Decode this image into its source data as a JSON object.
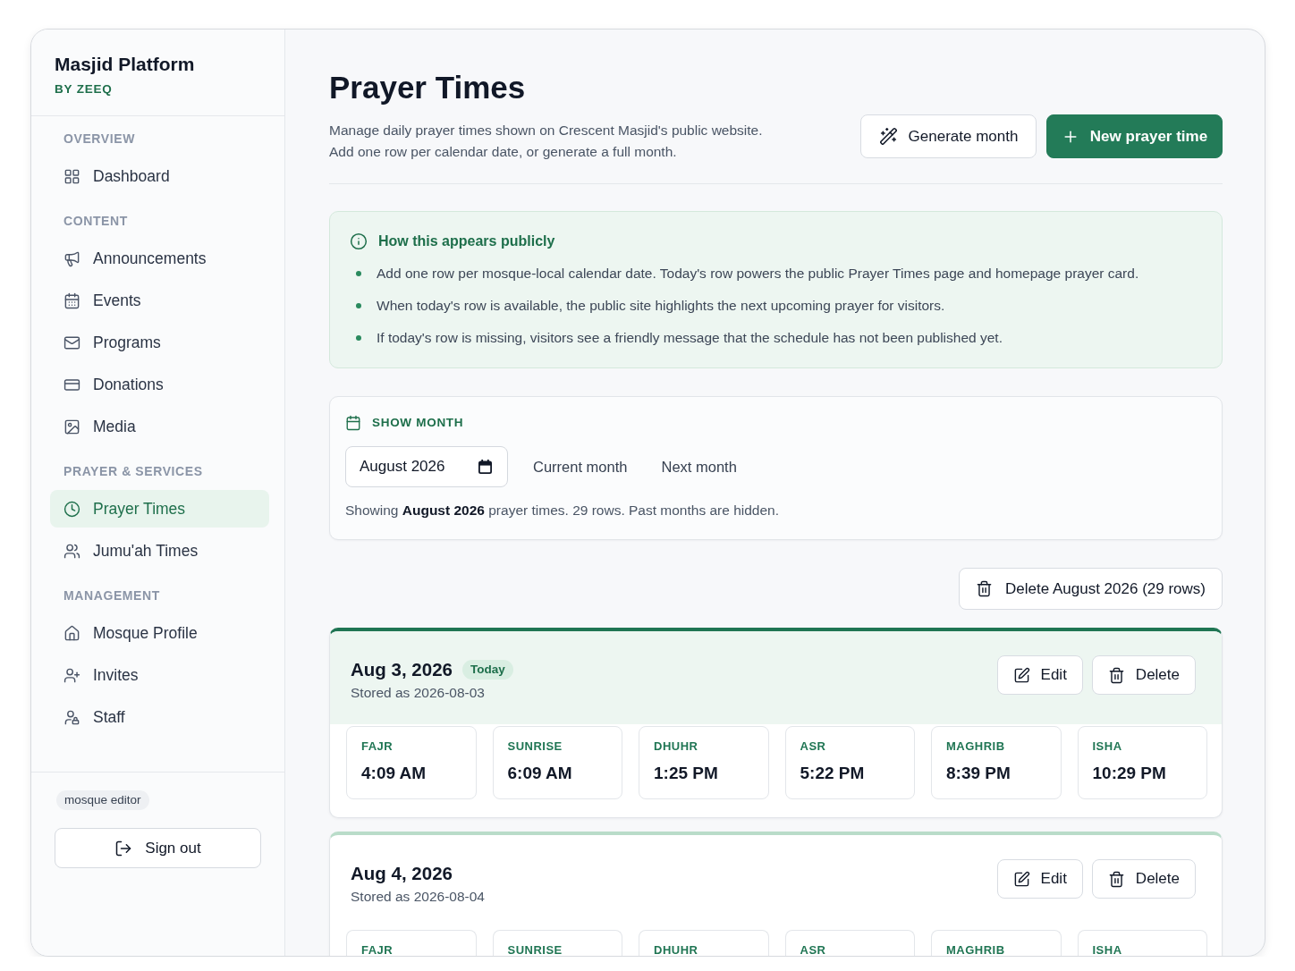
{
  "sidebar": {
    "brand": {
      "title": "Masjid Platform",
      "subtitle": "BY ZEEQ"
    },
    "sections": [
      {
        "heading": "OVERVIEW",
        "items": [
          {
            "label": "Dashboard",
            "selected": false
          }
        ]
      },
      {
        "heading": "CONTENT",
        "items": [
          {
            "label": "Announcements",
            "selected": false
          },
          {
            "label": "Events",
            "selected": false
          },
          {
            "label": "Programs",
            "selected": false
          },
          {
            "label": "Donations",
            "selected": false
          },
          {
            "label": "Media",
            "selected": false
          }
        ]
      },
      {
        "heading": "PRAYER & SERVICES",
        "items": [
          {
            "label": "Prayer Times",
            "selected": true
          },
          {
            "label": "Jumu'ah Times",
            "selected": false
          }
        ]
      },
      {
        "heading": "MANAGEMENT",
        "items": [
          {
            "label": "Mosque Profile",
            "selected": false
          },
          {
            "label": "Invites",
            "selected": false
          },
          {
            "label": "Staff",
            "selected": false
          }
        ]
      }
    ],
    "footer": {
      "role": "mosque editor",
      "sign_out": "Sign out"
    }
  },
  "header": {
    "title": "Prayer Times",
    "description": "Manage daily prayer times shown on Crescent Masjid's public website.\nAdd one row per calendar date, or generate a full month.",
    "buttons": [
      {
        "kind": "secondary",
        "label": "Generate month"
      },
      {
        "kind": "primary",
        "label": "New prayer time"
      }
    ]
  },
  "notice": {
    "title": "How this appears publicly",
    "bullets": [
      "Add one row per mosque-local calendar date. Today's row powers the public Prayer Times page and homepage prayer card.",
      "When today's row is available, the public site highlights the next upcoming prayer for visitors.",
      "If today's row is missing, visitors see a friendly message that the schedule has not been published yet."
    ]
  },
  "month_filter": {
    "heading": "SHOW MONTH",
    "value": "August 2026",
    "links": [
      "Current month",
      "Next month"
    ],
    "summary": "Showing **August 2026** prayer times. 29 rows. Past months are hidden."
  },
  "bulk_delete": "Delete August 2026 (29 rows)",
  "days": [
    {
      "date": "Aug 3, 2026",
      "badge": "Today",
      "today": true,
      "stored": "Stored as 2026-08-03",
      "actions": [
        "Edit",
        "Delete"
      ],
      "prayers": [
        {
          "name": "FAJR",
          "time": "4:09 AM"
        },
        {
          "name": "SUNRISE",
          "time": "6:09 AM"
        },
        {
          "name": "DHUHR",
          "time": "1:25 PM"
        },
        {
          "name": "ASR",
          "time": "5:22 PM"
        },
        {
          "name": "MAGHRIB",
          "time": "8:39 PM"
        },
        {
          "name": "ISHA",
          "time": "10:29 PM"
        }
      ]
    },
    {
      "date": "Aug 4, 2026",
      "today": false,
      "stored": "Stored as 2026-08-04",
      "actions": [
        "Edit",
        "Delete"
      ],
      "prayers": [
        {
          "name": "FAJR"
        },
        {
          "name": "SUNRISE"
        },
        {
          "name": "DHUHR"
        },
        {
          "name": "ASR"
        },
        {
          "name": "MAGHRIB"
        },
        {
          "name": "ISHA"
        }
      ]
    }
  ]
}
